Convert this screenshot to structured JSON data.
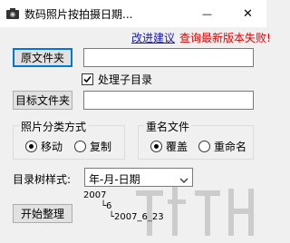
{
  "window": {
    "title": "数码照片按拍摄日期...",
    "minimize_glyph": "—",
    "close_glyph": "✕",
    "icon": "camera-icon"
  },
  "links": {
    "suggest": "改进建议",
    "update": "查询最新版本失败!"
  },
  "source": {
    "button_label": "原文件夹",
    "path_value": ""
  },
  "subdir": {
    "label": "处理子目录",
    "checked": true
  },
  "target": {
    "button_label": "目标文件夹",
    "path_value": ""
  },
  "classify": {
    "title": "照片分类方式",
    "options": [
      {
        "label": "移动",
        "selected": true
      },
      {
        "label": "复制",
        "selected": false
      }
    ]
  },
  "rename": {
    "title": "重名文件",
    "options": [
      {
        "label": "覆盖",
        "selected": true
      },
      {
        "label": "重命名",
        "selected": false
      }
    ]
  },
  "tree_style": {
    "label": "目录树样式:",
    "selected": "年-月-日期"
  },
  "tree_preview": {
    "lines": [
      "2007",
      "└6",
      "└2007_6_23"
    ]
  },
  "start_button": "开始整理",
  "colors": {
    "link_blue": "#1a1aa6",
    "error_red": "#e00000",
    "focus_blue": "#0078d7"
  }
}
